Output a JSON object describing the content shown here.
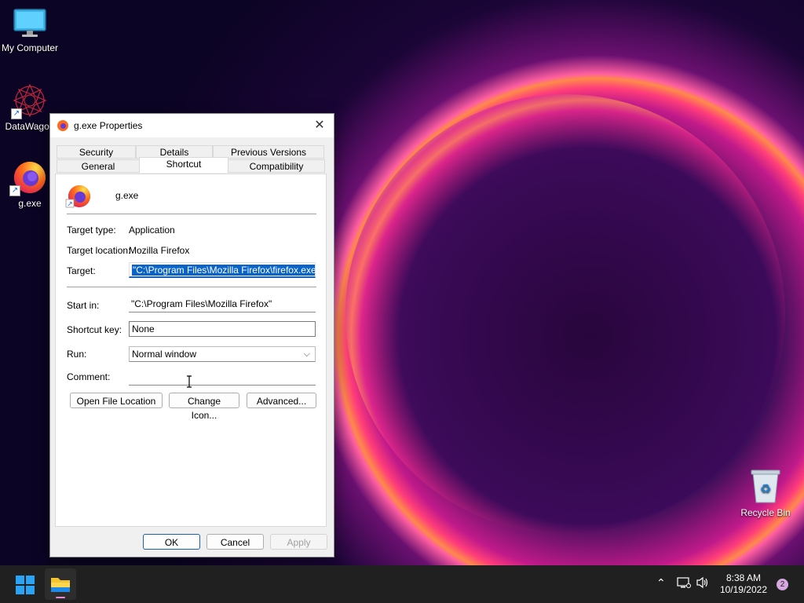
{
  "desktop": {
    "icons": [
      {
        "label": "My Computer"
      },
      {
        "label": "DataWagon"
      },
      {
        "label": "g.exe"
      },
      {
        "label": "Recycle Bin"
      }
    ]
  },
  "dialog": {
    "title": "g.exe Properties",
    "tabs_row1": [
      "Security",
      "Details",
      "Previous Versions"
    ],
    "tabs_row2": [
      "General",
      "Shortcut",
      "Compatibility"
    ],
    "active_tab": "Shortcut",
    "app_name": "g.exe",
    "target_type_label": "Target type:",
    "target_type_value": "Application",
    "target_location_label": "Target location:",
    "target_location_value": "Mozilla Firefox",
    "target_label": "Target:",
    "target_value": "\"C:\\Program Files\\Mozilla Firefox\\firefox.exe\"",
    "start_in_label": "Start in:",
    "start_in_value": "\"C:\\Program Files\\Mozilla Firefox\"",
    "shortcut_key_label": "Shortcut key:",
    "shortcut_key_value": "None",
    "run_label": "Run:",
    "run_value": "Normal window",
    "comment_label": "Comment:",
    "comment_value": "",
    "buttons": {
      "open_file_location": "Open File Location",
      "change_icon": "Change Icon...",
      "advanced": "Advanced...",
      "ok": "OK",
      "cancel": "Cancel",
      "apply": "Apply"
    }
  },
  "taskbar": {
    "time": "8:38 AM",
    "date": "10/19/2022",
    "notification_count": "2"
  }
}
